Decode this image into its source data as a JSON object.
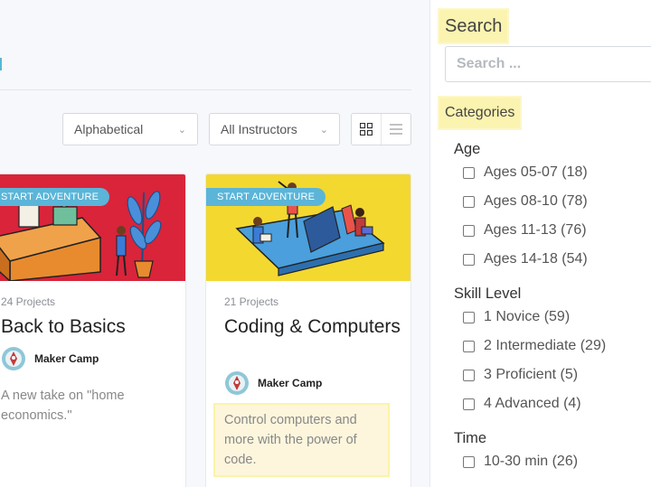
{
  "filters": {
    "sort": {
      "selected": "Alphabetical"
    },
    "instructor": {
      "selected": "All Instructors"
    }
  },
  "cards": [
    {
      "badge": "START ADVENTURE",
      "projects": "24 Projects",
      "title": "Back to Basics",
      "instructor": "Maker Camp",
      "description": "A new take on \"home economics.\""
    },
    {
      "badge": "START ADVENTURE",
      "projects": "21 Projects",
      "title": "Coding & Computers",
      "instructor": "Maker Camp",
      "description": "Control computers and more with the power of code."
    }
  ],
  "sidebar": {
    "search_title": "Search",
    "search_placeholder": "Search ...",
    "categories_title": "Categories",
    "groups": [
      {
        "title": "Age",
        "options": [
          "Ages 05-07 (18)",
          "Ages 08-10 (78)",
          "Ages 11-13 (76)",
          "Ages 14-18 (54)"
        ]
      },
      {
        "title": "Skill Level",
        "options": [
          "1 Novice (59)",
          "2 Intermediate (29)",
          "3 Proficient (5)",
          "4 Advanced (4)"
        ]
      },
      {
        "title": "Time",
        "options": [
          "10-30 min (26)"
        ]
      }
    ]
  },
  "colors": {
    "badge": "#5bb5d8",
    "highlight": "#fbf3b0",
    "card1_bg": "#d9243a",
    "card2_bg": "#f3d830"
  }
}
